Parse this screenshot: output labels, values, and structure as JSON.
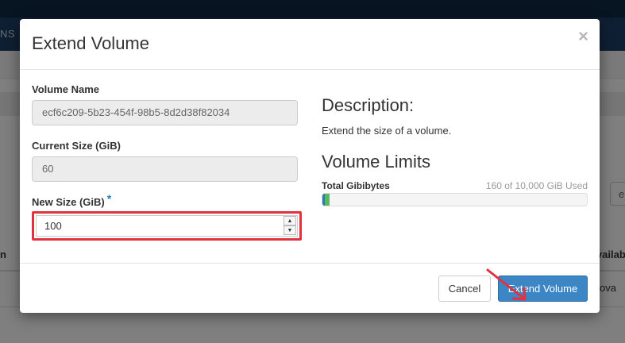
{
  "background": {
    "nav_fragment": "NS",
    "filter_fragment": "e",
    "column_left_fragment": "n",
    "column_right_fragment": "Availab",
    "row_right_fragment": "ova"
  },
  "modal": {
    "title": "Extend Volume",
    "close_symbol": "×",
    "form": {
      "volume_name_label": "Volume Name",
      "volume_name_value": "ecf6c209-5b23-454f-98b5-8d2d38f82034",
      "current_size_label": "Current Size (GiB)",
      "current_size_value": "60",
      "new_size_label": "New Size (GiB)",
      "new_size_required_marker": "*",
      "new_size_value": "100"
    },
    "description": {
      "heading": "Description:",
      "text": "Extend the size of a volume."
    },
    "limits": {
      "heading": "Volume Limits",
      "quota_label": "Total Gibibytes",
      "quota_used_text": "160 of 10,000 GiB Used",
      "used_fraction": 0.016
    },
    "footer": {
      "cancel_label": "Cancel",
      "submit_label": "Extend Volume"
    }
  },
  "colors": {
    "accent": "#3c86c6",
    "highlight": "#e2323f",
    "progress_blue": "#2a7ab8",
    "progress_green": "#5cb85c"
  },
  "icons": {
    "close": "close-icon",
    "spinner_up": "chevron-up-icon",
    "spinner_down": "chevron-down-icon",
    "annotation": "arrow-icon"
  }
}
